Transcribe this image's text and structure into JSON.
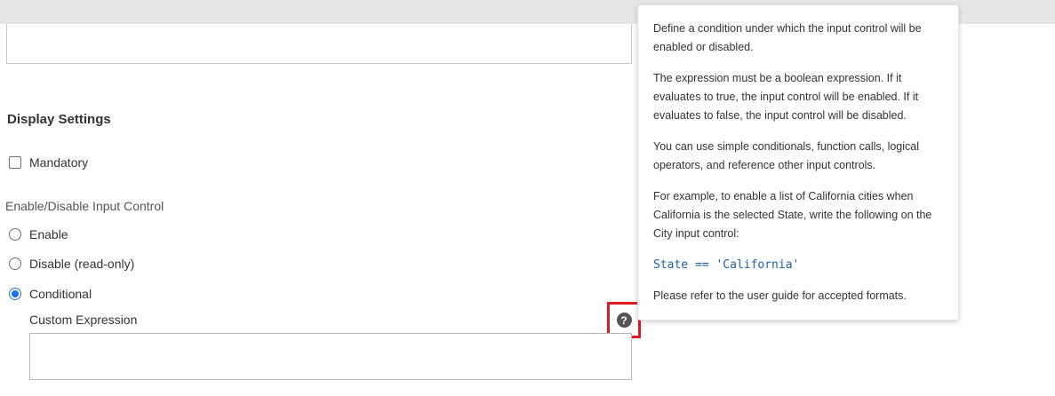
{
  "display_settings": {
    "title": "Display Settings",
    "mandatory_label": "Mandatory",
    "mandatory_checked": false
  },
  "enable_control": {
    "label": "Enable/Disable Input Control",
    "options": [
      {
        "label": "Enable",
        "selected": false
      },
      {
        "label": "Disable (read-only)",
        "selected": false
      },
      {
        "label": "Conditional",
        "selected": true
      }
    ]
  },
  "custom_expression": {
    "label": "Custom Expression",
    "value": "",
    "help_icon": "question-mark-icon"
  },
  "tooltip": {
    "paragraph_1": "Define a condition under which the input control will be enabled or disabled.",
    "paragraph_2": "The expression must be a boolean expression. If it evaluates to true, the input control will be enabled. If it evaluates to false, the input control will be disabled.",
    "paragraph_3": "You can use simple conditionals, function calls, logical operators, and reference other input controls.",
    "paragraph_4": "For example, to enable a list of California cities when California is the selected State, write the following on the City input control:",
    "code_example": "State == 'California'",
    "paragraph_5": "Please refer to the user guide for accepted formats."
  },
  "colors": {
    "accent": "#1a73e8",
    "highlight": "#e01b24",
    "code": "#1f5fa8"
  }
}
